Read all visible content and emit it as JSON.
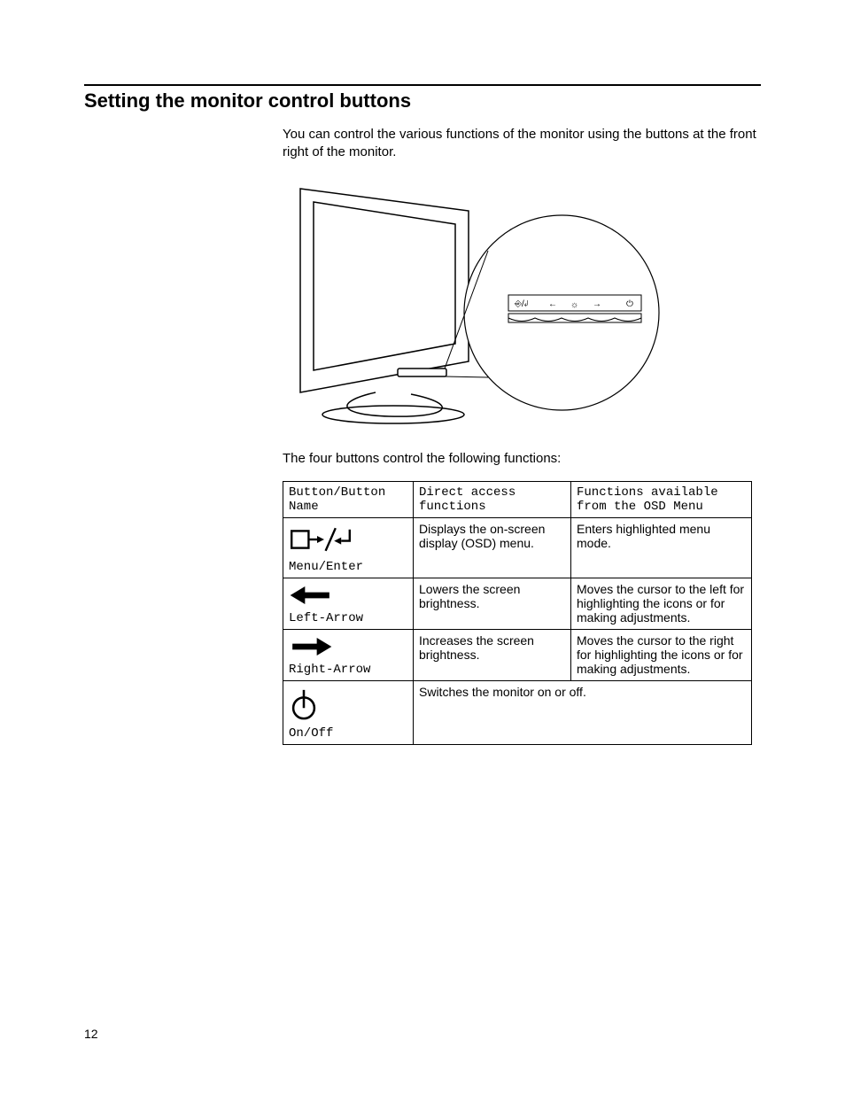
{
  "heading": "Setting the monitor control buttons",
  "intro": "You can control the various functions of the monitor using the buttons at the front right of the monitor.",
  "caption": "The four buttons control the following functions:",
  "panel_label": "⎆/↲   ←   ☼   →      ⏻",
  "table": {
    "headers": {
      "col1": "Button/Button Name",
      "col2": "Direct access functions",
      "col3": "Functions available from the OSD Menu"
    },
    "rows": [
      {
        "name": "Menu/Enter",
        "icon": "menu-enter-icon",
        "direct": "Displays the on-screen display (OSD) menu.",
        "osd": "Enters highlighted menu mode."
      },
      {
        "name": "Left-Arrow",
        "icon": "left-arrow-icon",
        "direct": "Lowers the screen brightness.",
        "osd": "Moves the cursor to the left for highlighting the icons or for making adjustments."
      },
      {
        "name": "Right-Arrow",
        "icon": "right-arrow-icon",
        "direct": "Increases the screen brightness.",
        "osd": "Moves the cursor to the right for highlighting the icons or for making adjustments."
      },
      {
        "name": "On/Off",
        "icon": "power-icon",
        "direct": "Switches the monitor on or off.",
        "osd": ""
      }
    ]
  },
  "page_number": "12"
}
